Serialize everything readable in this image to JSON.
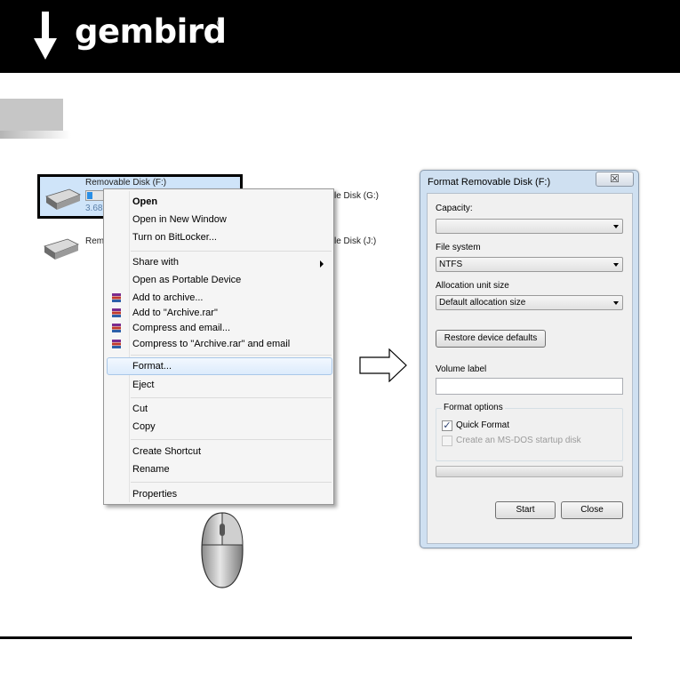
{
  "brand": {
    "name": "gembird",
    "reg": "®"
  },
  "explorer": {
    "drive_f_title": "Removable Disk (F:)",
    "drive_f_size": "3.68",
    "drive_g_title_partial": "le Disk (G:)",
    "drive_e_title_partial": "Rem",
    "drive_j_title_partial": "le Disk (J:)"
  },
  "context_menu": {
    "items": [
      {
        "label": "Open"
      },
      {
        "label": "Open in New Window"
      },
      {
        "label": "Turn on BitLocker..."
      },
      {
        "label": "Share with"
      },
      {
        "label": "Open as Portable Device"
      },
      {
        "label": "Add to archive..."
      },
      {
        "label": "Add to \"Archive.rar\""
      },
      {
        "label": "Compress and email..."
      },
      {
        "label": "Compress to \"Archive.rar\" and email"
      },
      {
        "label": "Format..."
      },
      {
        "label": "Eject"
      },
      {
        "label": "Cut"
      },
      {
        "label": "Copy"
      },
      {
        "label": "Create Shortcut"
      },
      {
        "label": "Rename"
      },
      {
        "label": "Properties"
      }
    ],
    "highlighted": "Format..."
  },
  "format_dialog": {
    "title": "Format Removable Disk (F:)",
    "close_glyph": "☒",
    "capacity_label": "Capacity:",
    "capacity_value": "",
    "file_system_label": "File system",
    "file_system_value": "NTFS",
    "allocation_label": "Allocation unit size",
    "allocation_value": "Default allocation size",
    "restore_button": "Restore device defaults",
    "volume_label": "Volume label",
    "volume_value": "",
    "format_options_label": "Format options",
    "quick_format_label": "Quick Format",
    "quick_format_checked": true,
    "msdos_label": "Create an MS-DOS startup disk",
    "msdos_checked": false,
    "progress": 0,
    "start_button": "Start",
    "close_button": "Close"
  },
  "colors": {
    "banner": "#000000",
    "selection": "#cfe4f9",
    "menu_highlight_border": "#a9c7e8",
    "dialog_frame": "#cfe0f1"
  },
  "icons": {
    "logo": "gembird-logo-icon",
    "drive": "usb-drive-icon",
    "archive": "winrar-icon",
    "submenu": "chevron-right-icon",
    "arrow": "right-arrow-icon",
    "mouse": "mouse-right-click-icon"
  }
}
